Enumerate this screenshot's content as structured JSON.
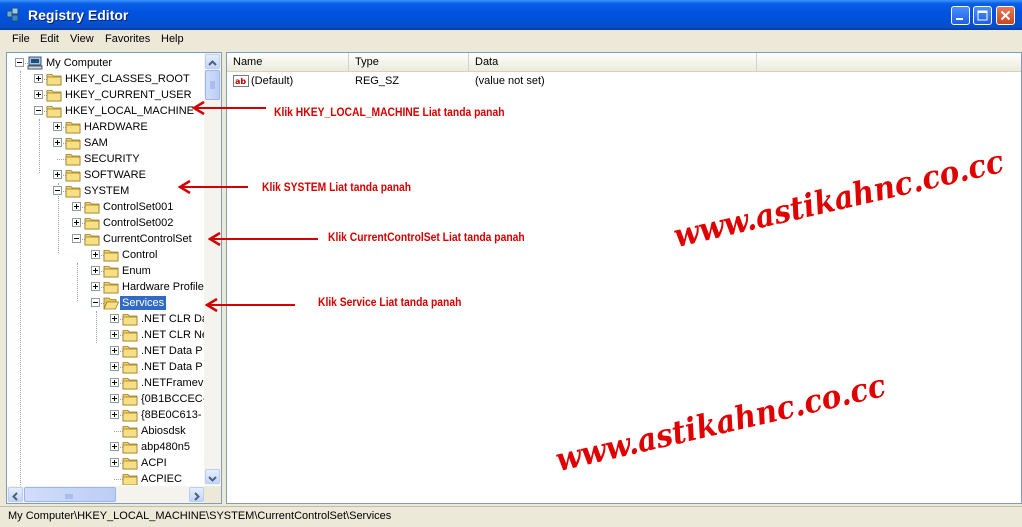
{
  "window": {
    "title": "Registry Editor"
  },
  "menu": [
    "File",
    "Edit",
    "View",
    "Favorites",
    "Help"
  ],
  "tree": [
    {
      "label": "My Computer",
      "depth": 0,
      "expander": "minus",
      "icon": "computer-icon"
    },
    {
      "label": "HKEY_CLASSES_ROOT",
      "depth": 1,
      "expander": "plus"
    },
    {
      "label": "HKEY_CURRENT_USER",
      "depth": 1,
      "expander": "plus"
    },
    {
      "label": "HKEY_LOCAL_MACHINE",
      "depth": 1,
      "expander": "minus"
    },
    {
      "label": "HARDWARE",
      "depth": 2,
      "expander": "plus"
    },
    {
      "label": "SAM",
      "depth": 2,
      "expander": "plus"
    },
    {
      "label": "SECURITY",
      "depth": 2,
      "expander": "none"
    },
    {
      "label": "SOFTWARE",
      "depth": 2,
      "expander": "plus"
    },
    {
      "label": "SYSTEM",
      "depth": 2,
      "expander": "minus"
    },
    {
      "label": "ControlSet001",
      "depth": 3,
      "expander": "plus"
    },
    {
      "label": "ControlSet002",
      "depth": 3,
      "expander": "plus"
    },
    {
      "label": "CurrentControlSet",
      "depth": 3,
      "expander": "minus"
    },
    {
      "label": "Control",
      "depth": 4,
      "expander": "plus"
    },
    {
      "label": "Enum",
      "depth": 4,
      "expander": "plus"
    },
    {
      "label": "Hardware Profile",
      "depth": 4,
      "expander": "plus"
    },
    {
      "label": "Services",
      "depth": 4,
      "expander": "minus",
      "selected": true,
      "open": true
    },
    {
      "label": ".NET CLR Da",
      "depth": 5,
      "expander": "plus"
    },
    {
      "label": ".NET CLR Ne",
      "depth": 5,
      "expander": "plus"
    },
    {
      "label": ".NET Data P",
      "depth": 5,
      "expander": "plus"
    },
    {
      "label": ".NET Data P",
      "depth": 5,
      "expander": "plus"
    },
    {
      "label": ".NETFramev",
      "depth": 5,
      "expander": "plus"
    },
    {
      "label": "{0B1BCCEC-",
      "depth": 5,
      "expander": "plus"
    },
    {
      "label": "{8BE0C613-",
      "depth": 5,
      "expander": "plus"
    },
    {
      "label": "Abiosdsk",
      "depth": 5,
      "expander": "none"
    },
    {
      "label": "abp480n5",
      "depth": 5,
      "expander": "plus"
    },
    {
      "label": "ACPI",
      "depth": 5,
      "expander": "plus"
    },
    {
      "label": "ACPIEC",
      "depth": 5,
      "expander": "none"
    }
  ],
  "list": {
    "columns": [
      "Name",
      "Type",
      "Data"
    ],
    "rows": [
      {
        "name": "(Default)",
        "type": "REG_SZ",
        "data": "(value not set)"
      }
    ]
  },
  "annotations": [
    "Klik HKEY_LOCAL_MACHINE Liat tanda panah",
    "Klik SYSTEM Liat tanda panah",
    "Klik CurrentControlSet  Liat tanda panah",
    "Klik Service Liat tanda panah"
  ],
  "watermarks": [
    "www.astikahnc.co.cc",
    "www.astikahnc.co.cc"
  ],
  "status": {
    "path": "My Computer\\HKEY_LOCAL_MACHINE\\SYSTEM\\CurrentControlSet\\Services"
  },
  "colors": {
    "annotation": "#d40000",
    "selection": "#316ac5",
    "titlebar": "#0053e0"
  }
}
